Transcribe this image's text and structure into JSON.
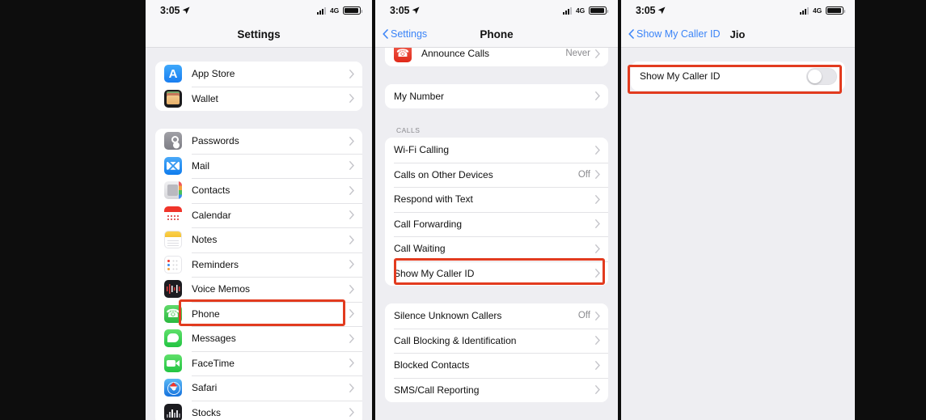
{
  "status_bar": {
    "time": "3:05",
    "location_icon": "location-arrow-icon",
    "signal_icon": "cellular-signal-icon",
    "network": "4G",
    "battery_icon": "battery-icon"
  },
  "panel1": {
    "title": "Settings",
    "groups": [
      {
        "items": [
          {
            "label": "App Store",
            "icon": "app-store-icon",
            "icon_class": "ic-appstore",
            "value": "",
            "chevron": true
          },
          {
            "label": "Wallet",
            "icon": "wallet-icon",
            "icon_class": "ic-wallet",
            "value": "",
            "chevron": true
          }
        ]
      },
      {
        "items": [
          {
            "label": "Passwords",
            "icon": "passwords-icon",
            "icon_class": "ic-pass",
            "value": "",
            "chevron": true
          },
          {
            "label": "Mail",
            "icon": "mail-icon",
            "icon_class": "ic-mail",
            "value": "",
            "chevron": true
          },
          {
            "label": "Contacts",
            "icon": "contacts-icon",
            "icon_class": "ic-contacts",
            "value": "",
            "chevron": true
          },
          {
            "label": "Calendar",
            "icon": "calendar-icon",
            "icon_class": "ic-cal",
            "value": "",
            "chevron": true
          },
          {
            "label": "Notes",
            "icon": "notes-icon",
            "icon_class": "ic-notes",
            "value": "",
            "chevron": true
          },
          {
            "label": "Reminders",
            "icon": "reminders-icon",
            "icon_class": "ic-rem",
            "value": "",
            "chevron": true
          },
          {
            "label": "Voice Memos",
            "icon": "voice-memos-icon",
            "icon_class": "ic-voice",
            "value": "",
            "chevron": true
          },
          {
            "label": "Phone",
            "icon": "phone-icon",
            "icon_class": "ic-phone",
            "value": "",
            "chevron": true,
            "highlighted": true
          },
          {
            "label": "Messages",
            "icon": "messages-icon",
            "icon_class": "ic-msg",
            "value": "",
            "chevron": true
          },
          {
            "label": "FaceTime",
            "icon": "facetime-icon",
            "icon_class": "ic-ft",
            "value": "",
            "chevron": true
          },
          {
            "label": "Safari",
            "icon": "safari-icon",
            "icon_class": "ic-safari",
            "value": "",
            "chevron": true
          },
          {
            "label": "Stocks",
            "icon": "stocks-icon",
            "icon_class": "ic-stocks",
            "value": "",
            "chevron": true
          }
        ]
      }
    ]
  },
  "panel2": {
    "back_label": "Settings",
    "title": "Phone",
    "partial_top": {
      "items": [
        {
          "label": "Announce Calls",
          "icon": "announce-calls-icon",
          "icon_class": "ic-announce",
          "value": "Never",
          "chevron": true
        }
      ]
    },
    "groups": [
      {
        "header": "",
        "items": [
          {
            "label": "My Number",
            "value": "",
            "chevron": true
          }
        ]
      },
      {
        "header": "CALLS",
        "items": [
          {
            "label": "Wi-Fi Calling",
            "value": "",
            "chevron": true
          },
          {
            "label": "Calls on Other Devices",
            "value": "Off",
            "chevron": true
          },
          {
            "label": "Respond with Text",
            "value": "",
            "chevron": true
          },
          {
            "label": "Call Forwarding",
            "value": "",
            "chevron": true
          },
          {
            "label": "Call Waiting",
            "value": "",
            "chevron": true
          },
          {
            "label": "Show My Caller ID",
            "value": "",
            "chevron": true,
            "highlighted": true
          }
        ]
      },
      {
        "header": "",
        "items": [
          {
            "label": "Silence Unknown Callers",
            "value": "Off",
            "chevron": true
          },
          {
            "label": "Call Blocking & Identification",
            "value": "",
            "chevron": true
          },
          {
            "label": "Blocked Contacts",
            "value": "",
            "chevron": true
          },
          {
            "label": "SMS/Call Reporting",
            "value": "",
            "chevron": true
          }
        ]
      }
    ]
  },
  "panel3": {
    "back_label": "Show My Caller ID",
    "title": "Jio",
    "groups": [
      {
        "items": [
          {
            "label": "Show My Caller ID",
            "toggle": true,
            "toggle_on": false,
            "highlighted": true
          }
        ]
      }
    ]
  },
  "colors": {
    "highlight": "#e23b1f",
    "tint": "#3b84f7",
    "background": "#eeeef2",
    "card": "#ffffff"
  }
}
